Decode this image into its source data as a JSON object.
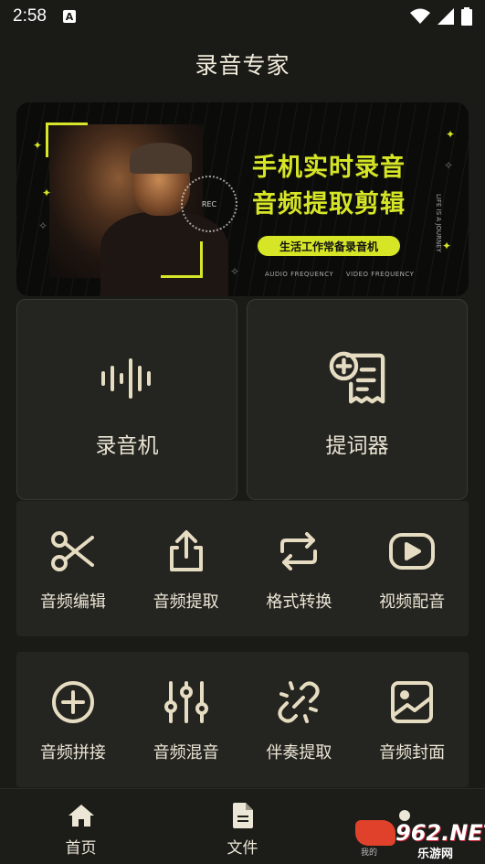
{
  "status": {
    "time": "2:58",
    "a_badge": "A"
  },
  "header": {
    "title": "录音专家"
  },
  "banner": {
    "headline_1": "手机实时录音",
    "headline_2": "音频提取剪辑",
    "tagline": "生活工作常备录音机",
    "footer_left": "AUDIO FREQUENCY",
    "footer_right": "VIDEO FREQUENCY",
    "side_text": "LIFE IS A JOURNEY",
    "rec_text": "REC"
  },
  "main_cards": [
    {
      "label": "录音机",
      "icon": "waveform-icon"
    },
    {
      "label": "提词器",
      "icon": "teleprompter-icon"
    }
  ],
  "tools_row_1": [
    {
      "label": "音频编辑",
      "icon": "scissors-icon"
    },
    {
      "label": "音频提取",
      "icon": "upload-icon"
    },
    {
      "label": "格式转换",
      "icon": "repeat-icon"
    },
    {
      "label": "视频配音",
      "icon": "play-video-icon"
    }
  ],
  "tools_row_2": [
    {
      "label": "音频拼接",
      "icon": "plus-circle-icon"
    },
    {
      "label": "音频混音",
      "icon": "sliders-icon"
    },
    {
      "label": "伴奏提取",
      "icon": "broken-link-icon"
    },
    {
      "label": "音频封面",
      "icon": "image-icon"
    }
  ],
  "nav": [
    {
      "label": "首页",
      "icon": "home-icon"
    },
    {
      "label": "文件",
      "icon": "file-icon"
    },
    {
      "label": "",
      "icon": "profile-icon"
    }
  ],
  "watermark": {
    "brand": "962.NET",
    "sub": "乐游网",
    "small": "我的"
  },
  "colors": {
    "background": "#1a1a16",
    "card": "#242420",
    "icon": "#e6dcc2",
    "accent": "#d6e526"
  }
}
